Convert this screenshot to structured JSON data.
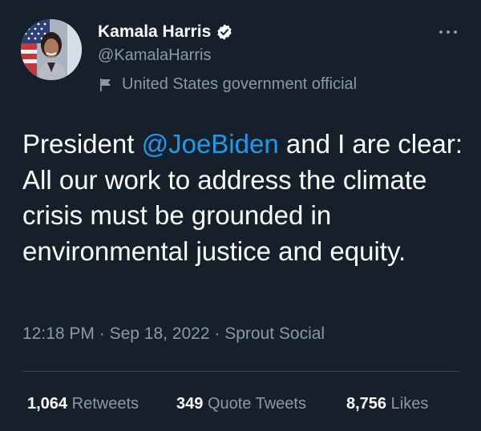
{
  "author": {
    "display_name": "Kamala Harris",
    "handle": "@KamalaHarris",
    "label": "United States government official",
    "verified": true
  },
  "tweet": {
    "text_before": "President ",
    "mention": "@JoeBiden",
    "text_after": " and I are clear: All our work to address the climate crisis must be grounded in environmental justice and equity."
  },
  "meta": {
    "time": "12:18 PM",
    "sep1": " · ",
    "date": "Sep 18, 2022",
    "sep2": " · ",
    "source": "Sprout Social"
  },
  "stats": {
    "retweets_count": "1,064",
    "retweets_label": "Retweets",
    "quotes_count": "349",
    "quotes_label": "Quote Tweets",
    "likes_count": "8,756",
    "likes_label": "Likes"
  },
  "icons": {
    "verified": "verified-badge-icon",
    "flag": "flag-icon",
    "more": "more-options-icon"
  },
  "colors": {
    "background": "#15202b",
    "text": "#ffffff",
    "secondary": "#8b98a5",
    "accent": "#1d9bf0",
    "divider": "#38444d"
  }
}
